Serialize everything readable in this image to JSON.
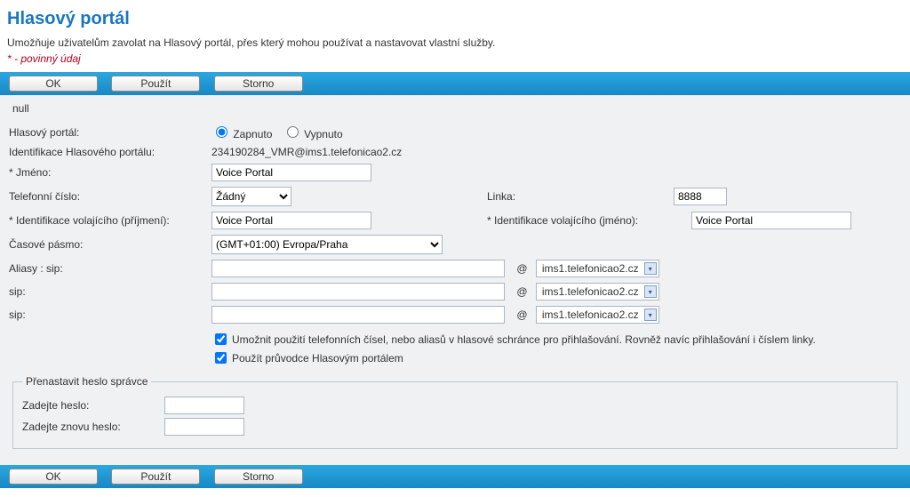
{
  "header": {
    "title": "Hlasový portál",
    "description": "Umožňuje uživatelům zavolat na Hlasový portál, přes který mohou používat a nastavovat vlastní služby.",
    "required_note": "* - povinný údaj"
  },
  "buttons": {
    "ok": "OK",
    "apply": "Použít",
    "cancel": "Storno"
  },
  "form": {
    "null_text": "null",
    "labels": {
      "portal": "Hlasový portál:",
      "portal_id": "Identifikace Hlasového portálu:",
      "name": "* Jméno:",
      "phone": "Telefonní číslo:",
      "line": "Linka:",
      "caller_id_last": "* Identifikace volajícího (příjmení):",
      "caller_id_first": "* Identifikace volajícího (jméno):",
      "timezone": "Časové pásmo:",
      "aliases": "Aliasy : sip:",
      "sip": "sip:"
    },
    "radio": {
      "on": "Zapnuto",
      "off": "Vypnuto"
    },
    "values": {
      "portal_id": "234190284_VMR@ims1.telefonicao2.cz",
      "name": "Voice Portal",
      "phone_selected": "Žádný",
      "line": "8888",
      "caller_id_last": "Voice Portal",
      "caller_id_first": "Voice Portal",
      "timezone": "(GMT+01:00) Evropa/Praha",
      "alias1": "",
      "alias2": "",
      "alias3": "",
      "domain": "ims1.telefonicao2.cz"
    },
    "checkboxes": {
      "allow_phone_login": "Umožnit použití telefonních čísel, nebo aliasů v hlasové schránce pro přihlašování. Rovněž navíc přihlašování i číslem linky.",
      "use_wizard": "Použít průvodce Hlasovým portálem"
    },
    "reset_pwd": {
      "legend": "Přenastavit heslo správce",
      "enter_pwd": "Zadejte heslo:",
      "reenter_pwd": "Zadejte znovu heslo:"
    }
  }
}
